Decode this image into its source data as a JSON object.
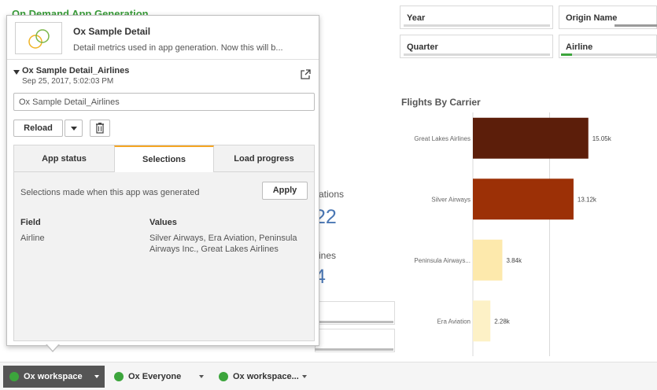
{
  "sheet": {
    "title": "On Demand App Generation",
    "kpi_fragment_1": "ations",
    "kpi_value_1": "22",
    "kpi_fragment_2": "ines",
    "kpi_value_2": "4"
  },
  "filters": {
    "year": "Year",
    "origin_name": "Origin Name",
    "quarter": "Quarter",
    "airline": "Airline"
  },
  "popup": {
    "app_title": "Ox Sample Detail",
    "app_description": "Detail metrics used in app generation. Now this will b...",
    "instance_name": "Ox Sample Detail_Airlines",
    "instance_date": "Sep 25, 2017, 5:02:03 PM",
    "name_input_value": "Ox Sample Detail_Airlines",
    "reload_label": "Reload",
    "tabs": [
      "App status",
      "Selections",
      "Load progress"
    ],
    "active_tab": "Selections",
    "selections_text": "Selections made when this app was generated",
    "apply_label": "Apply",
    "col_field": "Field",
    "col_values": "Values",
    "row_field": "Airline",
    "row_values_line1": "Silver Airways, Era Aviation, Peninsula",
    "row_values_line2": "Airways Inc., Great Lakes Airlines"
  },
  "workspaces": [
    {
      "label": "Ox workspace"
    },
    {
      "label": "Ox Everyone"
    },
    {
      "label": "Ox workspace..."
    }
  ],
  "colors": {
    "accent_green": "#3ca53c",
    "active_tab_orange": "#f5a623",
    "kpi_blue": "#4a77b4"
  },
  "chart_data": {
    "type": "bar",
    "orientation": "horizontal",
    "title": "Flights By Carrier",
    "categories": [
      "Great Lakes Airlines",
      "Silver Airways",
      "Peninsula Airways...",
      "Era Aviation"
    ],
    "values": [
      15050,
      13120,
      3840,
      2280
    ],
    "labels": [
      "15.05k",
      "13.12k",
      "3.84k",
      "2.28k"
    ],
    "colors": [
      "#5c1e0a",
      "#9c3006",
      "#fde9ac",
      "#fdf1c6"
    ],
    "xlim": [
      0,
      20000
    ],
    "gridlines": [
      0,
      10000
    ]
  }
}
